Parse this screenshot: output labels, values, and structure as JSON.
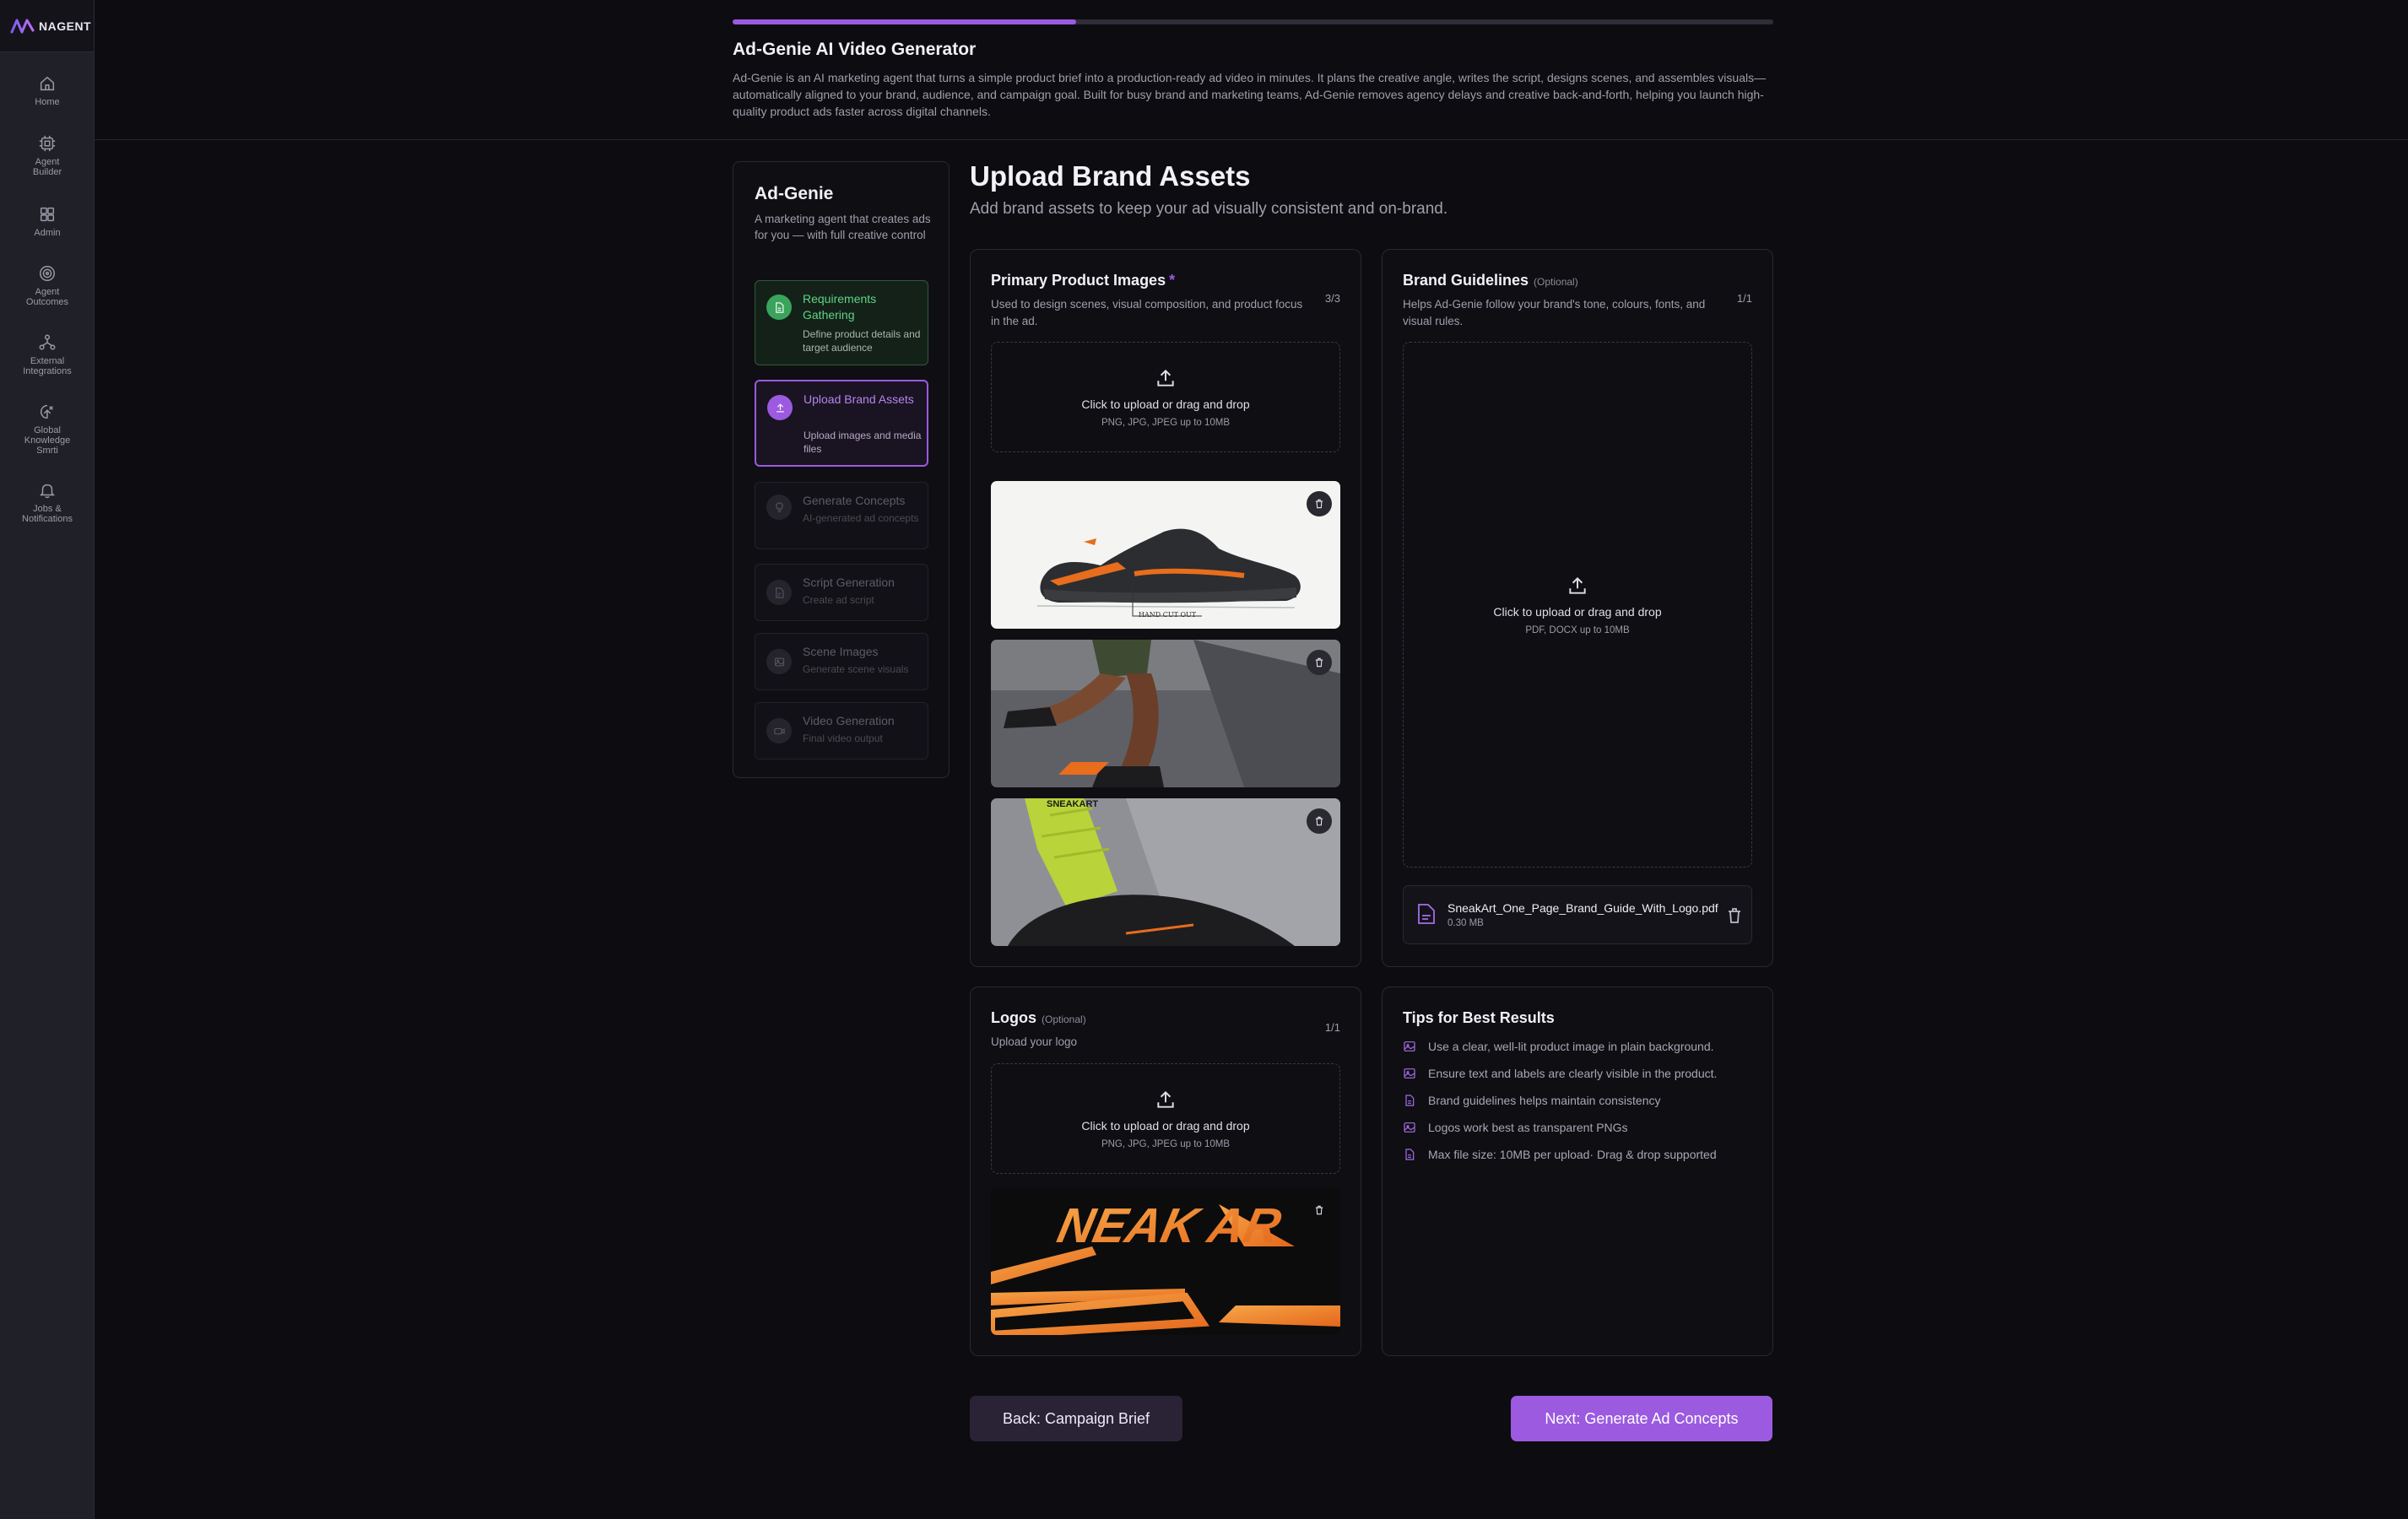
{
  "brand": {
    "name": "NAGENT",
    "accent": "#9b5ae0"
  },
  "nav": [
    {
      "label": "Home",
      "icon": "home-icon"
    },
    {
      "label": "Agent\nBuilder",
      "icon": "agent-builder-icon"
    },
    {
      "label": "Admin",
      "icon": "admin-grid-icon"
    },
    {
      "label": "Agent\nOutcomes",
      "icon": "target-icon"
    },
    {
      "label": "External\nIntegrations",
      "icon": "integrations-icon"
    },
    {
      "label": "Global\nKnowledge\nSmrti",
      "icon": "knowledge-icon"
    },
    {
      "label": "Jobs &\nNotifications",
      "icon": "bell-icon"
    }
  ],
  "header": {
    "progress": 0.33,
    "title": "Ad-Genie AI Video Generator",
    "description": "Ad-Genie is an AI marketing agent that turns a simple product brief into a production-ready ad video in minutes. It plans the creative angle, writes the script, designs scenes, and assembles visuals— automatically aligned to your brand, audience, and campaign goal. Built for busy brand and marketing teams, Ad-Genie removes agency delays and creative back-and-forth, helping you launch high-quality product ads faster across digital channels."
  },
  "stepper": {
    "title": "Ad-Genie",
    "description": "A marketing agent that creates ads for you — with full creative control",
    "steps": [
      {
        "title": "Requirements Gathering",
        "subtitle": "Define product details and target audience",
        "status": "done"
      },
      {
        "title": "Upload Brand Assets",
        "subtitle": "Upload images and media files",
        "status": "active"
      },
      {
        "title": "Generate Concepts",
        "subtitle": "AI-generated ad concepts",
        "status": "pending"
      },
      {
        "title": "Script Generation",
        "subtitle": "Create ad script",
        "status": "pending"
      },
      {
        "title": "Scene Images",
        "subtitle": "Generate scene visuals",
        "status": "pending"
      },
      {
        "title": "Video Generation",
        "subtitle": "Final video output",
        "status": "pending"
      }
    ]
  },
  "main": {
    "title": "Upload Brand Assets",
    "subtitle": "Add brand assets to keep your ad visually consistent and on-brand."
  },
  "product_images": {
    "title": "Primary Product Images",
    "required_mark": "*",
    "description": "Used to design scenes, visual composition, and product focus in the ad.",
    "count": "3/3",
    "upload_text": "Click to upload or drag and drop",
    "upload_hint": "PNG, JPG, JPEG up to 10MB",
    "images": [
      {
        "alt": "Black running shoe with orange accents",
        "caption": "HAND CUT OUT"
      },
      {
        "alt": "Runner legs wearing black and orange shoes"
      },
      {
        "alt": "Neon green sock with black shoe",
        "caption": "SNEAKART"
      }
    ]
  },
  "brand_guidelines": {
    "title": "Brand Guidelines",
    "optional": "(Optional)",
    "description": "Helps Ad-Genie follow your brand's tone, colours, fonts, and visual rules.",
    "count": "1/1",
    "upload_text": "Click to upload or drag and drop",
    "upload_hint": "PDF, DOCX up to 10MB",
    "file": {
      "name": "SneakArt_One_Page_Brand_Guide_With_Logo.pdf",
      "size": "0.30 MB"
    }
  },
  "logos": {
    "title": "Logos",
    "optional": "(Optional)",
    "description": "Upload your logo",
    "count": "1/1",
    "upload_text": "Click to upload or drag and drop",
    "upload_hint": "PNG, JPG, JPEG up to 10MB",
    "logo_text": "NEAK  AR"
  },
  "tips": {
    "title": "Tips for Best Results",
    "items": [
      {
        "text": "Use a clear, well-lit product image in plain background.",
        "icon": "image-icon"
      },
      {
        "text": "Ensure text and labels are clearly visible in the product.",
        "icon": "image-icon"
      },
      {
        "text": "Brand guidelines helps maintain consistency",
        "icon": "document-icon"
      },
      {
        "text": "Logos work best as transparent PNGs",
        "icon": "image-icon"
      },
      {
        "text": "Max file size: 10MB per upload· Drag & drop supported",
        "icon": "document-icon"
      }
    ]
  },
  "footer": {
    "back_label": "Back: Campaign Brief",
    "next_label": "Next: Generate Ad Concepts"
  }
}
